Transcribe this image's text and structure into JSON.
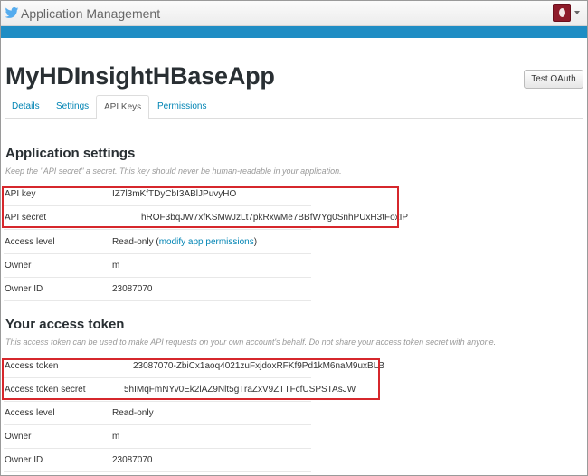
{
  "topbar": {
    "title": "Application Management"
  },
  "app": {
    "name": "MyHDInsightHBaseApp",
    "test_oauth_label": "Test OAuth"
  },
  "tabs": [
    "Details",
    "Settings",
    "API Keys",
    "Permissions"
  ],
  "application_settings": {
    "heading": "Application settings",
    "note": "Keep the \"API secret\" a secret. This key should never be human-readable in your application.",
    "rows": [
      {
        "label": "API key",
        "value": "IZ7l3mKfTDyCbI3ABlJPuvyHO"
      },
      {
        "label": "API secret",
        "value": "hROF3bqJW7xfKSMwJzLt7pkRxwMe7BBfWYg0SnhPUxH3tFoxIP"
      },
      {
        "label": "Access level",
        "value_prefix": "Read-only (",
        "link": "modify app permissions",
        "value_suffix": ")"
      },
      {
        "label": "Owner",
        "value": "m"
      },
      {
        "label": "Owner ID",
        "value": "23087070"
      }
    ]
  },
  "access_token": {
    "heading": "Your access token",
    "note": "This access token can be used to make API requests on your own account's behalf. Do not share your access token secret with anyone.",
    "rows": [
      {
        "label": "Access token",
        "value": "23087070-ZbiCx1aoq4021zuFxjdoxRFKf9Pd1kM6naM9uxBLB"
      },
      {
        "label": "Access token secret",
        "value": "5hIMqFmNYv0Ek2lAZ9Nlt5gTraZxV9ZTTFcfUSPSTAsJW"
      },
      {
        "label": "Access level",
        "value": "Read-only"
      },
      {
        "label": "Owner",
        "value": "m"
      },
      {
        "label": "Owner ID",
        "value": "23087070"
      }
    ]
  },
  "colors": {
    "accent_bar": "#1f8dc4",
    "link": "#0084b4",
    "highlight_box": "#d6272c"
  }
}
